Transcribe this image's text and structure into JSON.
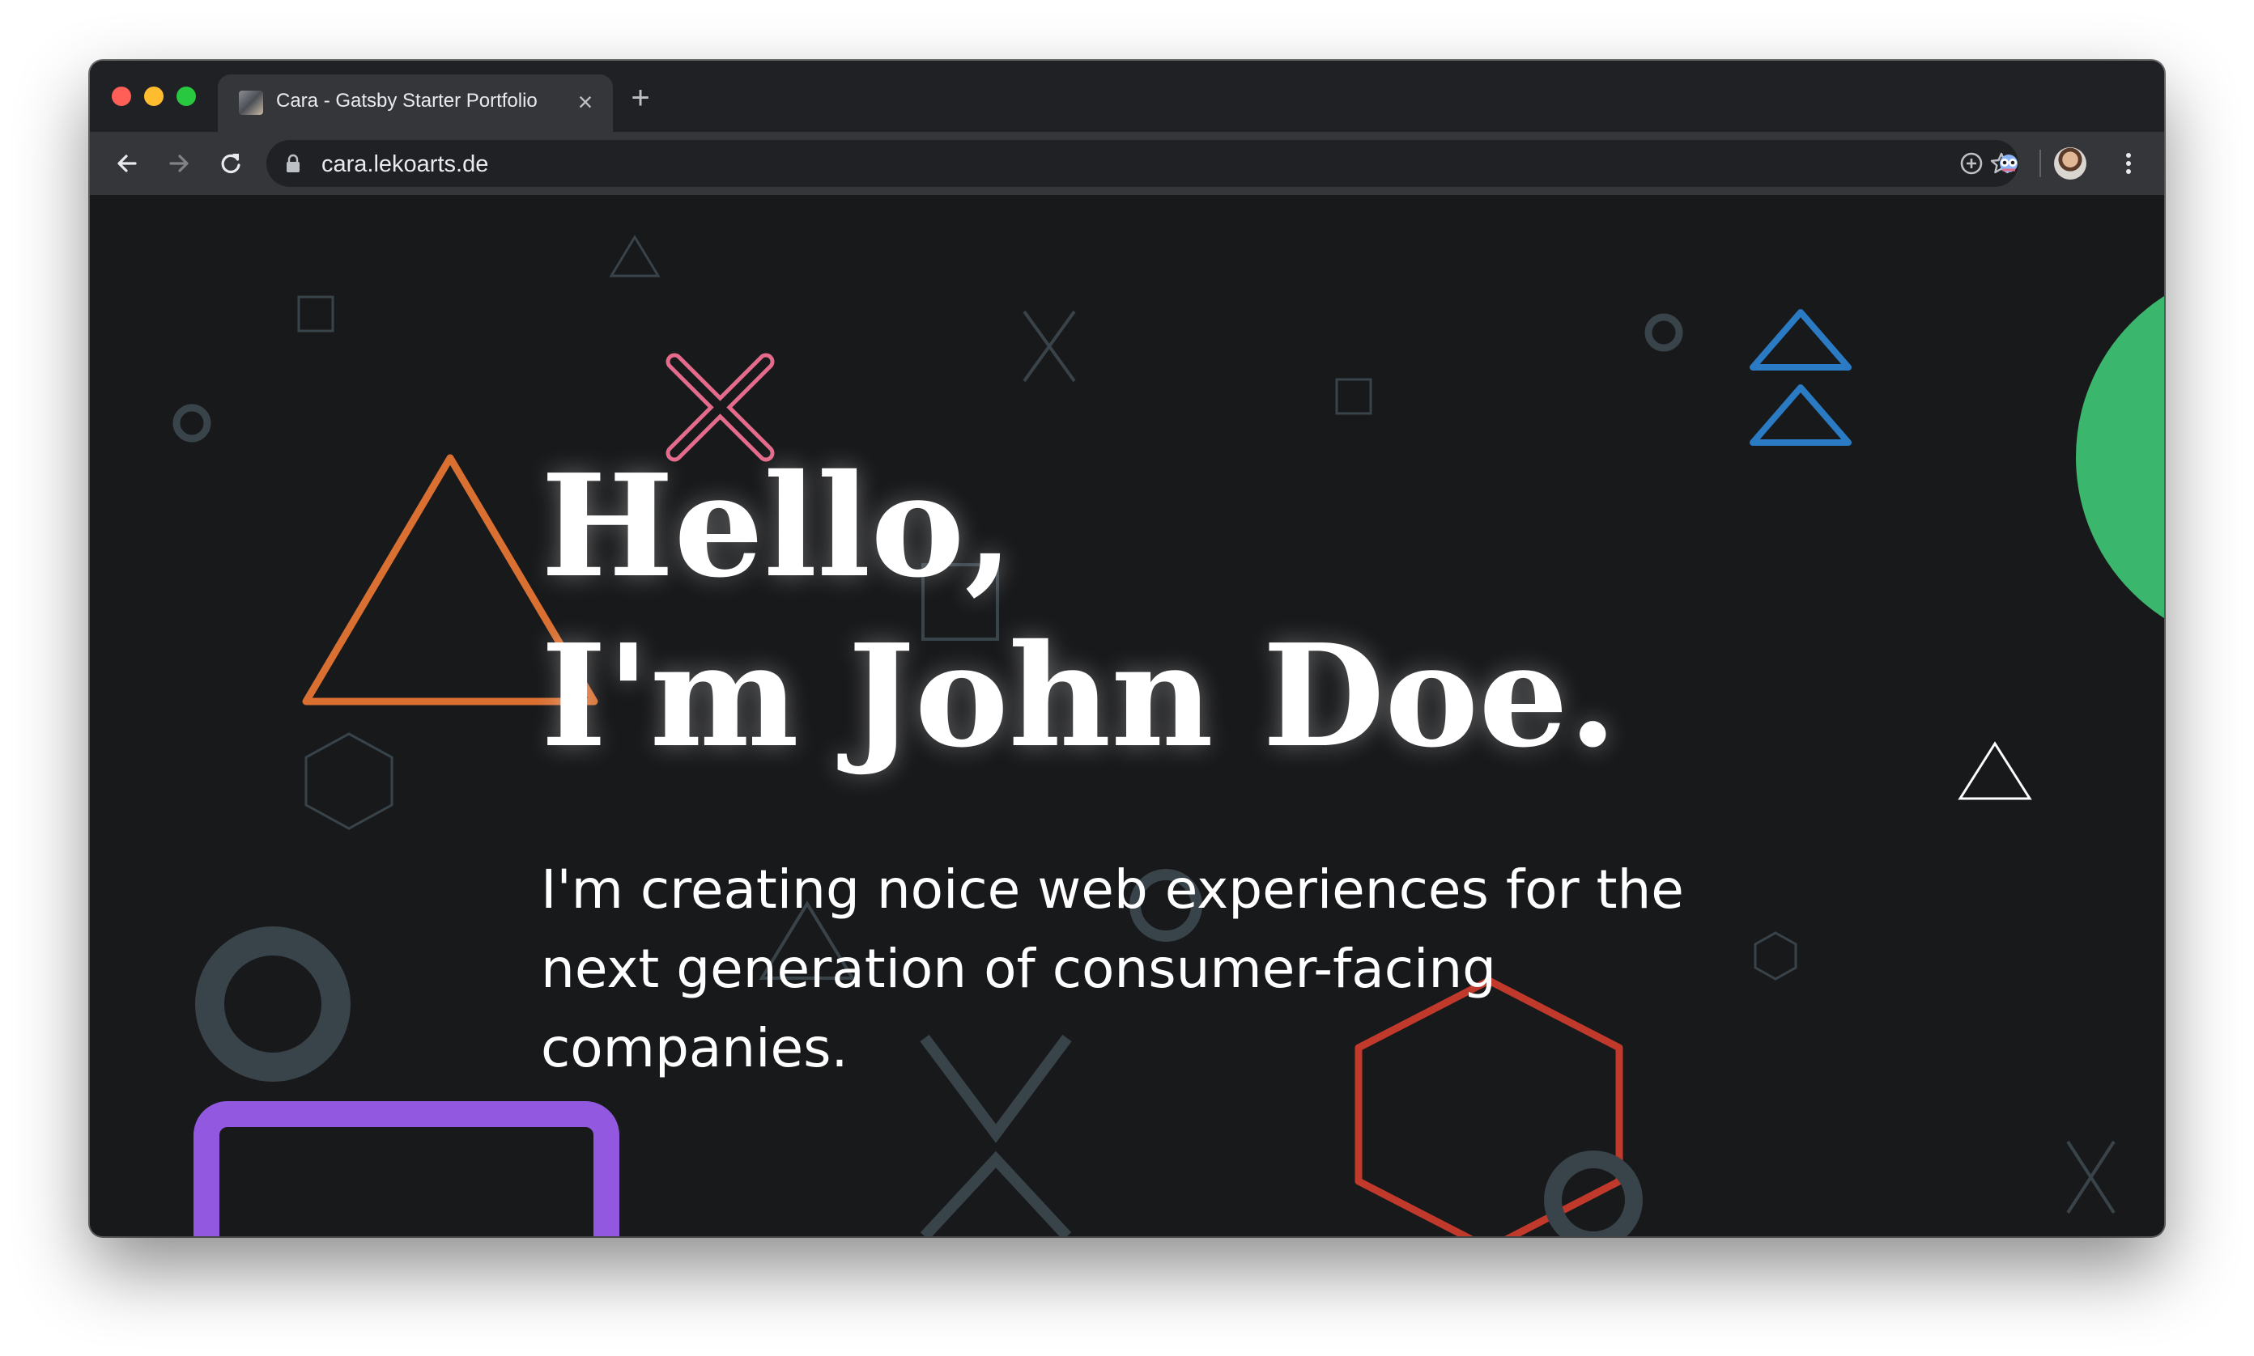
{
  "browser": {
    "tab": {
      "title": "Cara - Gatsby Starter Portfolio",
      "favicon": "site-favicon-icon"
    },
    "new_tab_icon": "plus-icon",
    "address_bar": {
      "url": "cara.lekoarts.de",
      "lock_icon": "lock-icon"
    },
    "toolbar_icons": [
      "back-arrow-icon",
      "forward-arrow-icon",
      "reload-icon",
      "add-circle-icon",
      "star-icon",
      "extension-icon",
      "profile-avatar",
      "menu-kebab-icon"
    ]
  },
  "page": {
    "greeting_line1": "Hello,",
    "greeting_line2": "I'm John Doe.",
    "description": "I'm creating noice web experiences for the next generation of consumer-facing companies."
  },
  "colors": {
    "background": "#18191b",
    "orange": "#d97032",
    "pink": "#e46b8c",
    "blue": "#2b7bc4",
    "green": "#3bb66d",
    "purple": "#9358e0",
    "red": "#c0392b",
    "grey": "#39434a"
  }
}
